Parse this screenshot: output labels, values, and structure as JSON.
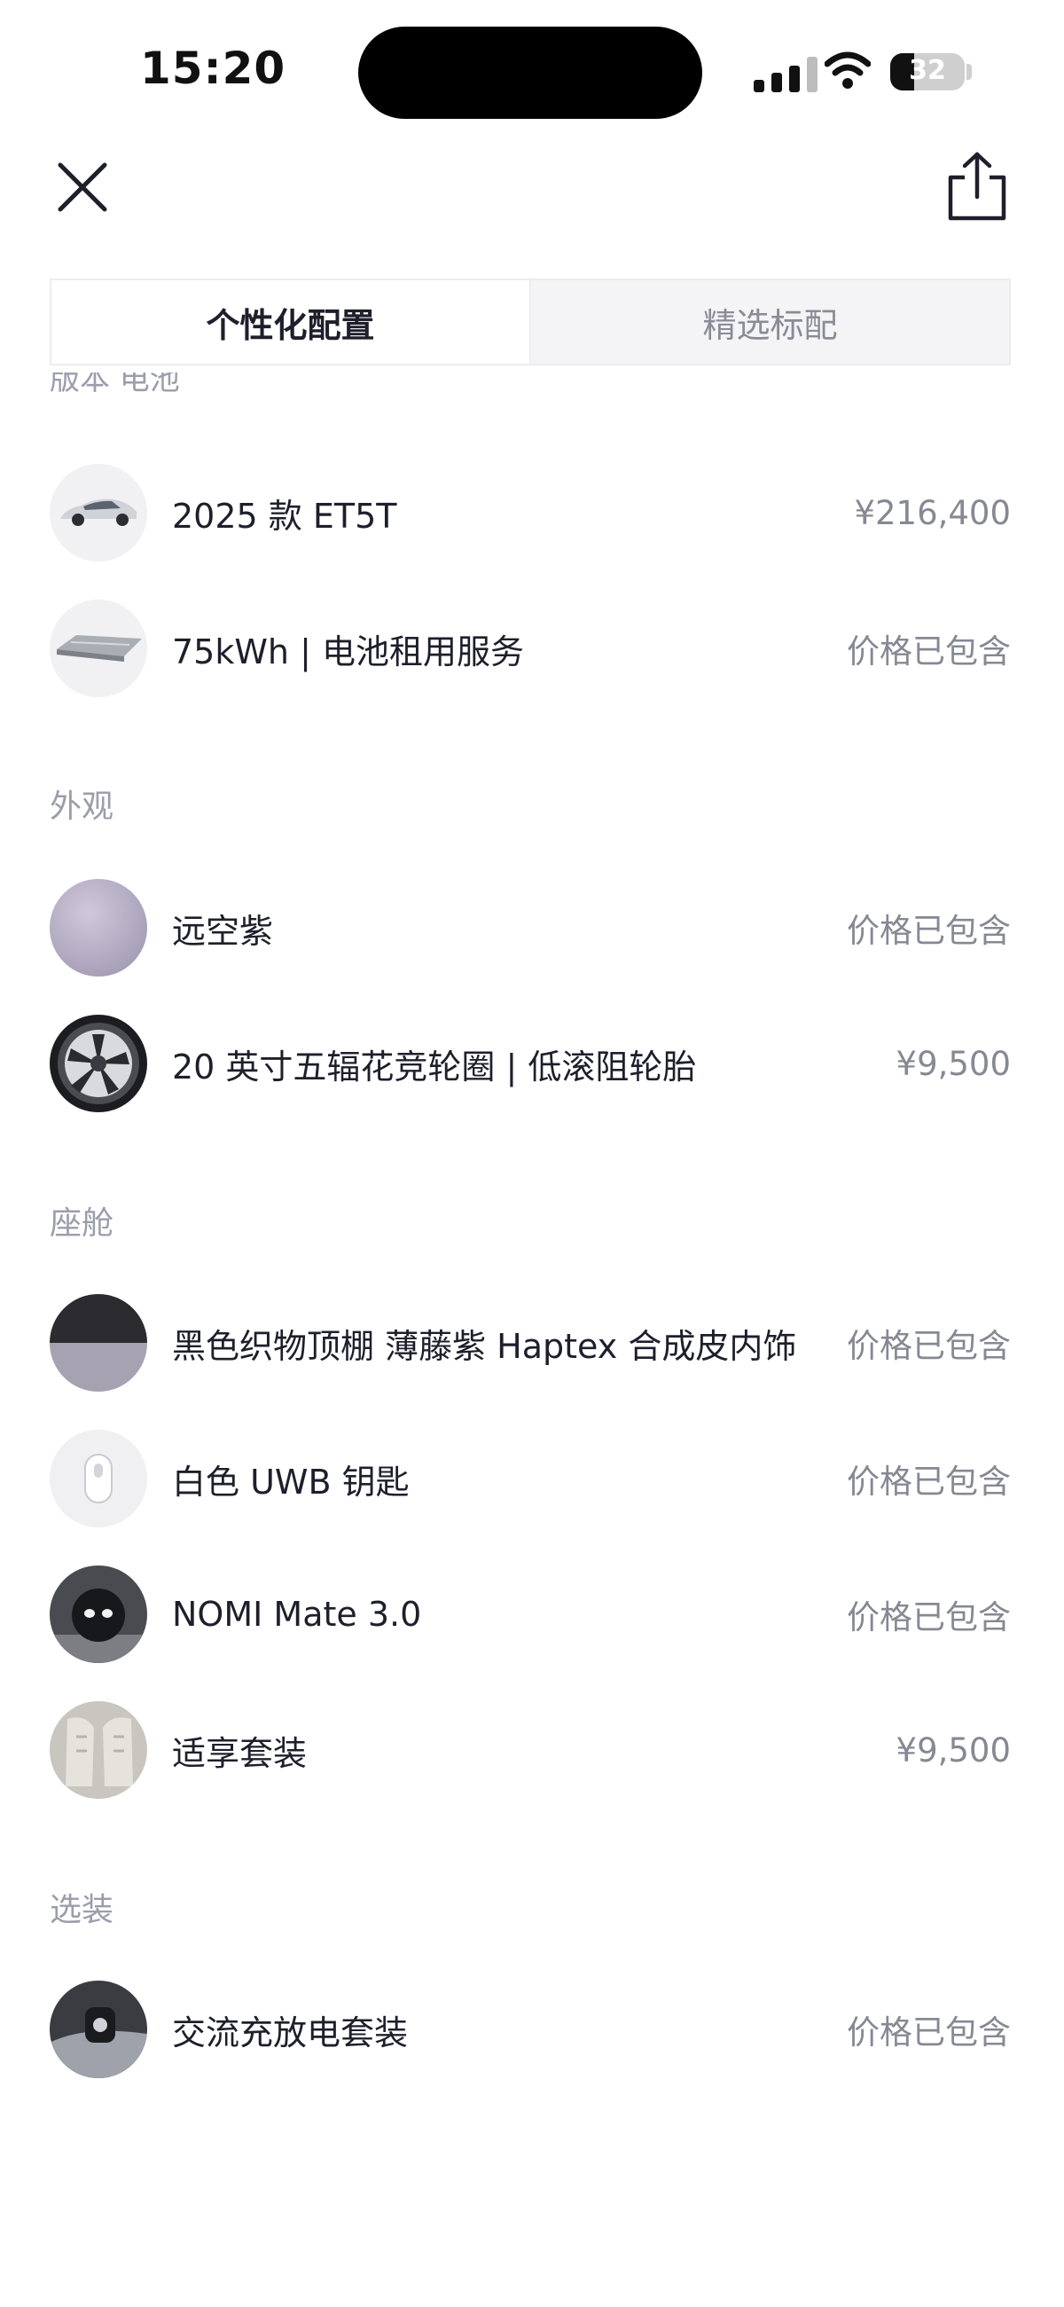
{
  "status_bar": {
    "time": "15:20",
    "battery": "32",
    "battery_level": 0.32
  },
  "tabs": [
    {
      "label": "个性化配置",
      "active": true
    },
    {
      "label": "精选标配",
      "active": false
    }
  ],
  "cut_heading": "版本 电池",
  "sections": [
    {
      "title": "",
      "items": [
        {
          "name": "2025 款 ET5T",
          "price": "¥216,400",
          "icon": "car-thumbnail"
        },
        {
          "name": "75kWh | 电池租用服务",
          "price": "价格已包含",
          "icon": "battery-pack-thumbnail"
        }
      ]
    },
    {
      "title": "外观",
      "items": [
        {
          "name": "远空紫",
          "price": "价格已包含",
          "icon": "paint-swatch-thumbnail",
          "color": "#b8b1c6"
        },
        {
          "name": "20 英寸五辐花竞轮圈 | 低滚阻轮胎",
          "price": "¥9,500",
          "icon": "wheel-thumbnail"
        }
      ]
    },
    {
      "title": "座舱",
      "items": [
        {
          "name": "黑色织物顶棚 薄藤紫 Haptex 合成皮内饰",
          "price": "价格已包含",
          "icon": "interior-swatch-thumbnail"
        },
        {
          "name": "白色 UWB 钥匙",
          "price": "价格已包含",
          "icon": "key-fob-thumbnail"
        },
        {
          "name": "NOMI Mate 3.0",
          "price": "价格已包含",
          "icon": "nomi-thumbnail"
        },
        {
          "name": "适享套装",
          "price": "¥9,500",
          "icon": "seat-thumbnail"
        }
      ]
    },
    {
      "title": "选装",
      "items": [
        {
          "name": "交流充放电套装",
          "price": "价格已包含",
          "icon": "charger-thumbnail"
        }
      ]
    }
  ]
}
